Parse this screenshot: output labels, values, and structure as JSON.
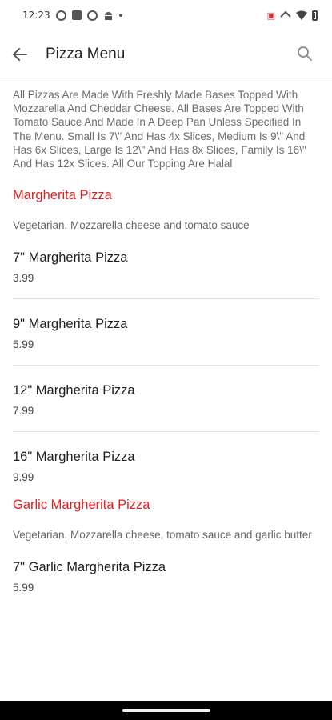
{
  "status_bar": {
    "time": "12:23",
    "left_icons": [
      "settings-icon",
      "square-app-icon",
      "sync-icon",
      "android-icon",
      "dot-icon"
    ],
    "right_icons": [
      "no-sim-icon",
      "data-icon",
      "wifi-icon",
      "battery-icon"
    ]
  },
  "header": {
    "title": "Pizza Menu",
    "back_icon": "arrow-left-icon",
    "search_icon": "search-icon"
  },
  "intro_text": "All Pizzas Are Made With Freshly Made Bases Topped With Mozzarella And Cheddar Cheese. All Bases Are Topped With Tomato Sauce And Made In A Deep Pan Unless Specified In The Menu. Small Is 7\\\" And Has 4x Slices, Medium Is 9\\\" And Has 6x Slices, Large Is 12\\\" And Has 8x Slices, Family Is 16\\\" And Has 12x Slices. All Our Topping Are Halal",
  "sections": [
    {
      "title": "Margherita Pizza",
      "description": "Vegetarian. Mozzarella cheese and tomato sauce",
      "items": [
        {
          "name": "7\" Margherita Pizza",
          "price": "3.99"
        },
        {
          "name": "9\" Margherita Pizza",
          "price": "5.99"
        },
        {
          "name": "12\" Margherita Pizza",
          "price": "7.99"
        },
        {
          "name": "16\" Margherita Pizza",
          "price": "9.99"
        }
      ]
    },
    {
      "title": "Garlic Margherita Pizza",
      "description": "Vegetarian. Mozzarella cheese, tomato sauce and garlic butter",
      "items": [
        {
          "name": "7\" Garlic Margherita Pizza",
          "price": "5.99"
        }
      ]
    }
  ],
  "colors": {
    "section_title": "#e02020",
    "text": "#222222",
    "muted": "#6d6d6d"
  }
}
